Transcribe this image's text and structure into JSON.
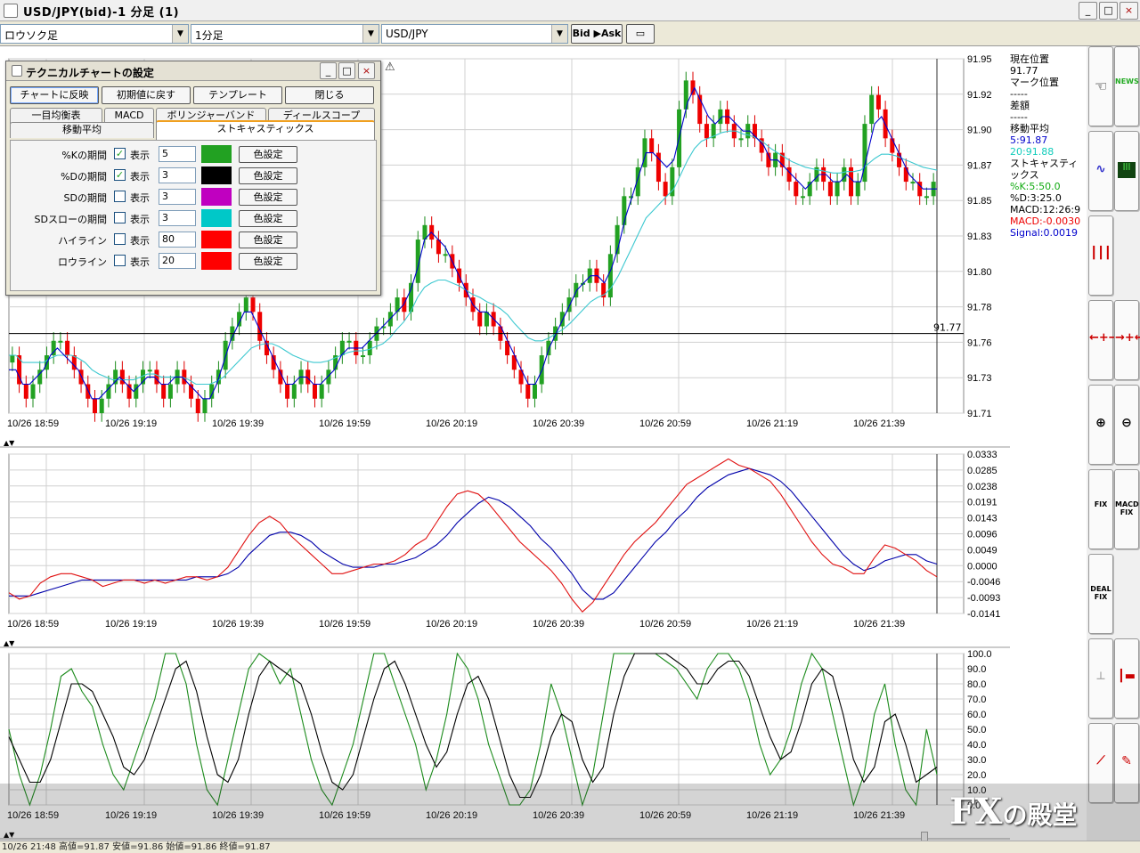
{
  "window": {
    "title": "USD/JPY(bid)-1 分足 (1)",
    "controls": [
      "_",
      "□",
      "×"
    ]
  },
  "toolbar": {
    "chart_type": "ロウソク足",
    "timeframe": "1分足",
    "pair": "USD/JPY",
    "bid_ask_label": "Bid ▶Ask"
  },
  "info": {
    "current_pos_label": "現在位置",
    "current_pos_value": "91.77",
    "mark_pos_label": "マーク位置",
    "mark_pos_value": "-----",
    "diff_label": "差額",
    "diff_value": "-----",
    "ma_label": "移動平均",
    "ma5": "5:91.87",
    "ma20": "20:91.88",
    "stoch_label": "ストキャスティックス",
    "stoch_k": "%K:5:50.0",
    "stoch_d": "%D:3:25.0",
    "macd": "MACD:12:26:9",
    "macd_val": "MACD:-0.0030",
    "signal_val": "Signal:0.0019"
  },
  "dialog": {
    "title": "テクニカルチャートの設定",
    "buttons": [
      "チャートに反映",
      "初期値に戻す",
      "テンプレート",
      "閉じる"
    ],
    "tabs_row1": [
      "一目均衡表",
      "MACD",
      "ボリンジャーバンド",
      "ディールスコープ"
    ],
    "tabs_row2": [
      "移動平均",
      "ストキャスティックス"
    ],
    "show_label": "表示",
    "color_button": "色設定",
    "params": [
      {
        "label": "%Kの期間",
        "checked": true,
        "value": "5",
        "color": "#22a122"
      },
      {
        "label": "%Dの期間",
        "checked": true,
        "value": "3",
        "color": "#000000"
      },
      {
        "label": "SDの期間",
        "checked": false,
        "value": "3",
        "color": "#c000c0"
      },
      {
        "label": "SDスローの期間",
        "checked": false,
        "value": "3",
        "color": "#00c8c8"
      },
      {
        "label": "ハイライン",
        "checked": false,
        "value": "80",
        "color": "#ff0000"
      },
      {
        "label": "ロウライン",
        "checked": false,
        "value": "20",
        "color": "#ff0000"
      }
    ]
  },
  "status": {
    "text": "10/26 21:48 高値=91.87 安値=91.86 始値=91.86 終値=91.87"
  },
  "watermark": {
    "big": "FX",
    "small": "の殿堂"
  },
  "side_buttons": [
    "hand-icon",
    "news-icon",
    "wave-icon",
    "bars-icon",
    "candle-icon",
    "expand-icon",
    "shrink-icon",
    "zoom-in-icon",
    "zoom-out-icon",
    "fix-icon",
    "macd-fix-icon",
    "deal-fix-icon",
    "stub-icon",
    "bar-red-icon",
    "line-icon",
    "pen-icon"
  ],
  "side_labels": {
    "news": "NEWS",
    "fix": "FIX",
    "macd_fix": "MACD FIX",
    "deal_fix": "DEAL FIX"
  },
  "chart_data": [
    {
      "type": "candlestick",
      "title": "",
      "x_ticks": [
        "10/26 18:59",
        "10/26 19:19",
        "10/26 19:39",
        "10/26 19:59",
        "10/26 20:19",
        "10/26 20:39",
        "10/26 20:59",
        "10/26 21:19",
        "10/26 21:39"
      ],
      "y_ticks": [
        "91.95",
        "91.92",
        "91.90",
        "91.87",
        "91.85",
        "91.83",
        "91.80",
        "91.78",
        "91.76",
        "91.73",
        "91.71"
      ],
      "ylim": [
        91.71,
        91.955
      ],
      "current_price_label": "91.77",
      "current_price": 91.765,
      "close": [
        91.75,
        91.73,
        91.72,
        91.73,
        91.74,
        91.75,
        91.76,
        91.76,
        91.75,
        91.74,
        91.73,
        91.72,
        91.71,
        91.72,
        91.73,
        91.74,
        91.73,
        91.72,
        91.73,
        91.74,
        91.74,
        91.73,
        91.72,
        91.73,
        91.74,
        91.73,
        91.72,
        91.71,
        91.72,
        91.73,
        91.74,
        91.76,
        91.77,
        91.78,
        91.79,
        91.78,
        91.76,
        91.75,
        91.74,
        91.73,
        91.72,
        91.73,
        91.74,
        91.73,
        91.72,
        91.73,
        91.74,
        91.75,
        91.76,
        91.76,
        91.75,
        91.75,
        91.76,
        91.77,
        91.77,
        91.78,
        91.79,
        91.78,
        91.8,
        91.83,
        91.84,
        91.83,
        91.82,
        91.82,
        91.81,
        91.8,
        91.79,
        91.78,
        91.77,
        91.78,
        91.77,
        91.76,
        91.75,
        91.74,
        91.73,
        91.72,
        91.73,
        91.75,
        91.76,
        91.77,
        91.78,
        91.79,
        91.8,
        91.8,
        91.81,
        91.8,
        91.79,
        91.82,
        91.84,
        91.86,
        91.86,
        91.88,
        91.9,
        91.89,
        91.87,
        91.86,
        91.88,
        91.92,
        91.94,
        91.93,
        91.91,
        91.9,
        91.91,
        91.92,
        91.91,
        91.9,
        91.9,
        91.91,
        91.9,
        91.89,
        91.88,
        91.89,
        91.88,
        91.87,
        91.86,
        91.86,
        91.87,
        91.88,
        91.87,
        91.86,
        91.87,
        91.88,
        91.86,
        91.87,
        91.91,
        91.93,
        91.92,
        91.9,
        91.89,
        91.88,
        91.87,
        91.87,
        91.86,
        91.86,
        91.87
      ],
      "ma5": [
        91.74,
        91.74,
        91.73,
        91.73,
        91.735,
        91.74,
        91.75,
        91.755,
        91.75,
        91.745,
        91.74,
        91.73,
        91.72,
        91.72,
        91.725,
        91.73,
        91.735,
        91.73,
        91.725,
        91.73,
        91.735,
        91.735,
        91.73,
        91.73,
        91.735,
        91.735,
        91.73,
        91.725,
        91.72,
        91.72,
        91.73,
        91.745,
        91.76,
        91.77,
        91.78,
        91.78,
        91.77,
        91.76,
        91.75,
        91.74,
        91.73,
        91.73,
        91.735,
        91.735,
        91.73,
        91.73,
        91.735,
        91.74,
        91.75,
        91.755,
        91.755,
        91.755,
        91.76,
        91.765,
        91.77,
        91.775,
        91.78,
        91.785,
        91.795,
        91.81,
        91.83,
        91.835,
        91.83,
        91.825,
        91.815,
        91.805,
        91.795,
        91.785,
        91.78,
        91.78,
        91.775,
        91.77,
        91.76,
        91.75,
        91.74,
        91.73,
        91.73,
        91.74,
        91.755,
        91.765,
        91.775,
        91.785,
        91.795,
        91.8,
        91.805,
        91.805,
        91.8,
        91.81,
        91.825,
        91.845,
        91.86,
        91.875,
        91.89,
        91.89,
        91.885,
        91.88,
        91.885,
        91.905,
        91.925,
        91.935,
        91.925,
        91.915,
        91.91,
        91.915,
        91.915,
        91.91,
        91.905,
        91.905,
        91.9,
        91.895,
        91.885,
        91.885,
        91.88,
        91.875,
        91.87,
        91.865,
        91.87,
        91.875,
        91.875,
        91.87,
        91.87,
        91.875,
        91.87,
        91.87,
        91.89,
        91.91,
        91.915,
        91.905,
        91.895,
        91.885,
        91.875,
        91.87,
        91.865,
        91.865,
        91.865
      ],
      "ma20": [
        91.75,
        91.75,
        91.745,
        91.745,
        91.745,
        91.745,
        91.748,
        91.75,
        91.75,
        91.75,
        91.748,
        91.745,
        91.74,
        91.737,
        91.735,
        91.733,
        91.733,
        91.733,
        91.733,
        91.735,
        91.737,
        91.737,
        91.735,
        91.735,
        91.735,
        91.735,
        91.733,
        91.73,
        91.73,
        91.73,
        91.732,
        91.735,
        91.74,
        91.745,
        91.75,
        91.755,
        91.757,
        91.758,
        91.758,
        91.756,
        91.753,
        91.75,
        91.748,
        91.746,
        91.745,
        91.745,
        91.746,
        91.748,
        91.75,
        91.752,
        91.753,
        91.753,
        91.754,
        91.756,
        91.758,
        91.762,
        91.768,
        91.773,
        91.78,
        91.79,
        91.797,
        91.8,
        91.802,
        91.802,
        91.8,
        91.798,
        91.795,
        91.792,
        91.79,
        91.787,
        91.785,
        91.782,
        91.778,
        91.772,
        91.767,
        91.762,
        91.76,
        91.76,
        91.762,
        91.765,
        91.768,
        91.772,
        91.777,
        91.782,
        91.787,
        91.79,
        91.792,
        91.797,
        91.805,
        91.815,
        91.825,
        91.835,
        91.845,
        91.85,
        91.855,
        91.86,
        91.865,
        91.875,
        91.885,
        91.893,
        91.898,
        91.9,
        91.902,
        91.904,
        91.905,
        91.905,
        91.903,
        91.902,
        91.9,
        91.897,
        91.893,
        91.89,
        91.887,
        91.884,
        91.882,
        91.88,
        91.879,
        91.878,
        91.877,
        91.876,
        91.876,
        91.877,
        91.877,
        91.878,
        91.882,
        91.886,
        91.889,
        91.889,
        91.888,
        91.886,
        91.884,
        91.882,
        91.88,
        91.879,
        91.878
      ]
    },
    {
      "type": "line",
      "title": "",
      "name": "MACD",
      "y_ticks": [
        "0.0333",
        "0.0285",
        "0.0238",
        "0.0191",
        "0.0143",
        "0.0096",
        "0.0049",
        "0.0000",
        "-0.0046",
        "-0.0093",
        "-0.0141"
      ],
      "ylim": [
        -0.0155,
        0.0345
      ],
      "x_ticks": [
        "10/26 18:59",
        "10/26 19:19",
        "10/26 19:39",
        "10/26 19:59",
        "10/26 20:19",
        "10/26 20:39",
        "10/26 20:59",
        "10/26 21:19",
        "10/26 21:39"
      ],
      "macd": [
        -0.009,
        -0.011,
        -0.01,
        -0.006,
        -0.004,
        -0.003,
        -0.003,
        -0.004,
        -0.005,
        -0.007,
        -0.006,
        -0.005,
        -0.005,
        -0.006,
        -0.005,
        -0.006,
        -0.005,
        -0.004,
        -0.004,
        -0.005,
        -0.004,
        -0.001,
        0.004,
        0.009,
        0.013,
        0.015,
        0.013,
        0.009,
        0.006,
        0.003,
        0.0,
        -0.003,
        -0.003,
        -0.002,
        -0.001,
        0.0,
        0.0,
        0.001,
        0.003,
        0.006,
        0.008,
        0.013,
        0.018,
        0.022,
        0.023,
        0.022,
        0.019,
        0.015,
        0.011,
        0.007,
        0.004,
        0.001,
        -0.002,
        -0.006,
        -0.011,
        -0.015,
        -0.012,
        -0.007,
        -0.002,
        0.003,
        0.007,
        0.01,
        0.013,
        0.017,
        0.021,
        0.025,
        0.027,
        0.029,
        0.031,
        0.033,
        0.031,
        0.03,
        0.028,
        0.026,
        0.022,
        0.017,
        0.012,
        0.007,
        0.003,
        0.0,
        -0.001,
        -0.003,
        -0.003,
        0.002,
        0.006,
        0.005,
        0.003,
        0.001,
        -0.002,
        -0.004
      ],
      "signal": [
        -0.01,
        -0.01,
        -0.01,
        -0.009,
        -0.008,
        -0.007,
        -0.006,
        -0.005,
        -0.005,
        -0.005,
        -0.005,
        -0.005,
        -0.005,
        -0.005,
        -0.005,
        -0.005,
        -0.005,
        -0.005,
        -0.004,
        -0.004,
        -0.004,
        -0.003,
        -0.001,
        0.003,
        0.006,
        0.009,
        0.01,
        0.01,
        0.009,
        0.007,
        0.004,
        0.002,
        0.0,
        -0.001,
        -0.001,
        -0.001,
        0.0,
        0.0,
        0.001,
        0.002,
        0.004,
        0.006,
        0.009,
        0.013,
        0.016,
        0.019,
        0.021,
        0.02,
        0.018,
        0.015,
        0.012,
        0.008,
        0.005,
        0.001,
        -0.003,
        -0.008,
        -0.011,
        -0.011,
        -0.009,
        -0.005,
        -0.001,
        0.003,
        0.007,
        0.01,
        0.014,
        0.017,
        0.021,
        0.024,
        0.026,
        0.028,
        0.029,
        0.03,
        0.029,
        0.028,
        0.026,
        0.023,
        0.019,
        0.015,
        0.011,
        0.007,
        0.003,
        0.0,
        -0.002,
        -0.001,
        0.001,
        0.002,
        0.003,
        0.003,
        0.001,
        0.0
      ]
    },
    {
      "type": "line",
      "title": "",
      "name": "Stochastics",
      "y_ticks": [
        "100.0",
        "90.0",
        "80.0",
        "70.0",
        "60.0",
        "50.0",
        "40.0",
        "30.0",
        "20.0",
        "10.0",
        "0.0"
      ],
      "ylim": [
        0,
        100
      ],
      "x_ticks": [
        "10/26 18:59",
        "10/26 19:19",
        "10/26 19:39",
        "10/26 19:59",
        "10/26 20:19",
        "10/26 20:39",
        "10/26 20:59",
        "10/26 21:19",
        "10/26 21:39"
      ],
      "k": [
        50,
        20,
        0,
        20,
        50,
        85,
        90,
        75,
        65,
        40,
        20,
        10,
        30,
        50,
        70,
        100,
        100,
        80,
        40,
        10,
        0,
        30,
        60,
        90,
        100,
        95,
        80,
        90,
        60,
        30,
        10,
        0,
        20,
        40,
        70,
        100,
        100,
        80,
        60,
        40,
        10,
        30,
        60,
        100,
        90,
        70,
        40,
        20,
        0,
        0,
        10,
        40,
        80,
        60,
        30,
        0,
        20,
        60,
        100,
        100,
        100,
        100,
        100,
        95,
        90,
        80,
        70,
        90,
        100,
        100,
        90,
        70,
        40,
        20,
        30,
        50,
        80,
        100,
        90,
        60,
        30,
        0,
        20,
        60,
        80,
        40,
        10,
        0,
        50,
        20
      ],
      "d": [
        45,
        30,
        15,
        15,
        30,
        55,
        80,
        80,
        75,
        60,
        45,
        25,
        20,
        30,
        50,
        70,
        90,
        95,
        75,
        45,
        20,
        15,
        30,
        60,
        85,
        95,
        90,
        85,
        80,
        60,
        35,
        15,
        10,
        20,
        45,
        70,
        90,
        95,
        80,
        60,
        40,
        25,
        35,
        60,
        80,
        85,
        70,
        45,
        20,
        5,
        5,
        20,
        45,
        60,
        55,
        30,
        15,
        25,
        60,
        85,
        100,
        100,
        100,
        100,
        95,
        90,
        80,
        80,
        90,
        95,
        95,
        85,
        65,
        45,
        30,
        35,
        55,
        80,
        90,
        85,
        60,
        30,
        15,
        25,
        55,
        60,
        40,
        15,
        20,
        25
      ]
    }
  ]
}
